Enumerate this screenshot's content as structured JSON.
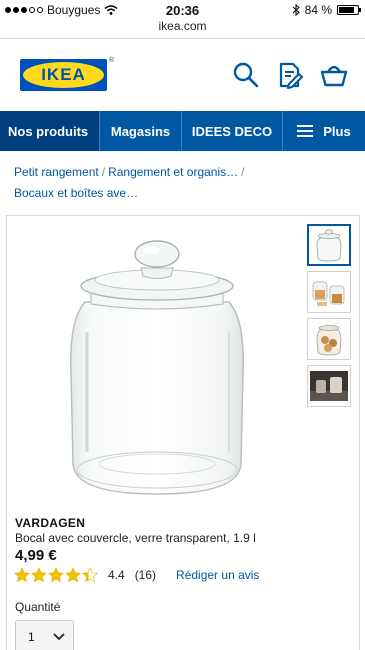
{
  "status_bar": {
    "carrier": "Bouygues",
    "time": "20:36",
    "battery": "84 %",
    "battery_level": 0.84,
    "url": "ikea.com"
  },
  "header": {
    "logo_text": "IKEA",
    "logo_reg": "®",
    "icons": [
      "search-icon",
      "shopping-list-icon",
      "cart-icon"
    ],
    "brand_blue": "#0058a3",
    "brand_yellow": "#ffda1a"
  },
  "nav": {
    "items": [
      "Nos produits",
      "Magasins",
      "IDEES DECO",
      "Plus"
    ]
  },
  "breadcrumb": {
    "items": [
      "Petit rangement",
      "Rangement et organis…",
      "Bocaux et boîtes ave…"
    ],
    "separator": "/"
  },
  "product": {
    "name": "VARDAGEN",
    "description": "Bocal avec couvercle, verre transparent, 1.9 l",
    "price": "4,99 €",
    "rating_value": "4.4",
    "rating_stars": 4.4,
    "rating_count": "(16)",
    "review_link": "Rédiger un avis",
    "quantity_label": "Quantité",
    "quantity_value": "1",
    "thumbnails": 4
  }
}
